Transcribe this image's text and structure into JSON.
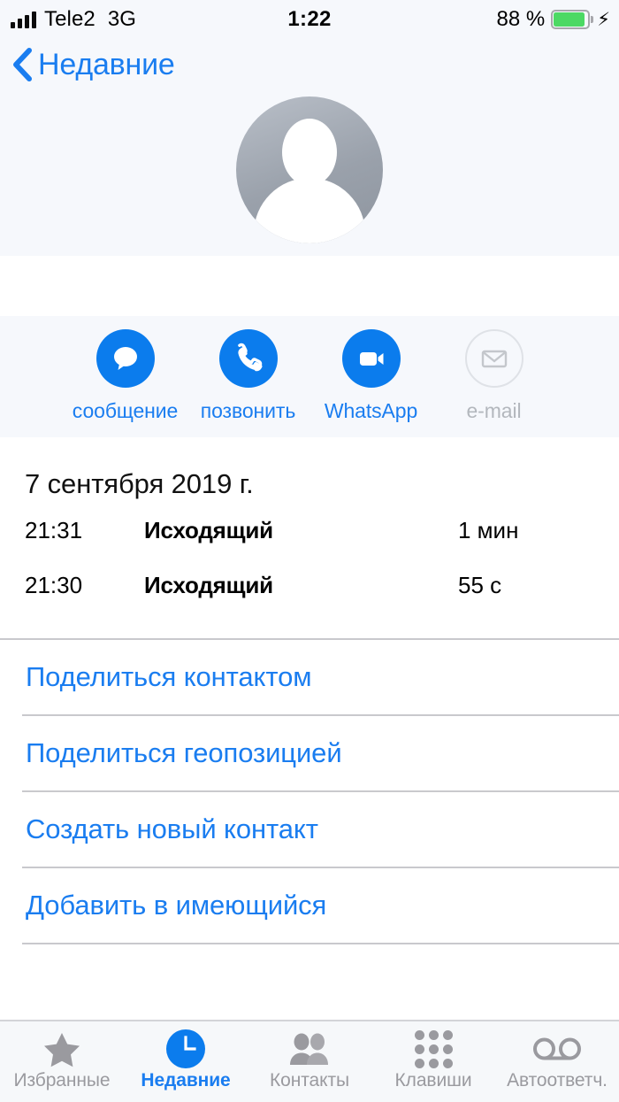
{
  "status_bar": {
    "carrier": "Tele2",
    "network": "3G",
    "time": "1:22",
    "battery_percent": "88 %",
    "charging_icon": "lightning-bolt-icon",
    "signal_icon": "signal-bars-icon",
    "battery_color": "#4cd964"
  },
  "nav": {
    "back_label": "Недавние",
    "back_icon": "chevron-left-icon"
  },
  "header": {
    "avatar_icon": "person-placeholder-avatar",
    "contact_name": ""
  },
  "actions": [
    {
      "label": "сообщение",
      "icon": "message-bubble-icon",
      "disabled": false
    },
    {
      "label": "позвонить",
      "icon": "phone-handset-icon",
      "disabled": false
    },
    {
      "label": "WhatsApp",
      "icon": "video-camera-icon",
      "disabled": false
    },
    {
      "label": "e-mail",
      "icon": "envelope-icon",
      "disabled": true
    }
  ],
  "history": {
    "date": "7 сентября 2019 г.",
    "calls": [
      {
        "time": "21:31",
        "type": "Исходящий",
        "duration": "1 мин"
      },
      {
        "time": "21:30",
        "type": "Исходящий",
        "duration": "55 с"
      }
    ]
  },
  "links": [
    {
      "label": "Поделиться контактом"
    },
    {
      "label": "Поделиться геопозицией"
    },
    {
      "label": "Создать новый контакт"
    },
    {
      "label": "Добавить в имеющийся"
    }
  ],
  "tabs": [
    {
      "label": "Избранные",
      "icon": "star-icon",
      "active": false
    },
    {
      "label": "Недавние",
      "icon": "clock-icon",
      "active": true
    },
    {
      "label": "Контакты",
      "icon": "people-icon",
      "active": false
    },
    {
      "label": "Клавиши",
      "icon": "keypad-icon",
      "active": false
    },
    {
      "label": "Автоответч.",
      "icon": "voicemail-icon",
      "active": false
    }
  ],
  "colors": {
    "accent_blue": "#1a7df0",
    "icon_blue": "#0b7ced",
    "inactive_gray": "#9a9a9f",
    "header_bg": "#f6f8fc"
  }
}
